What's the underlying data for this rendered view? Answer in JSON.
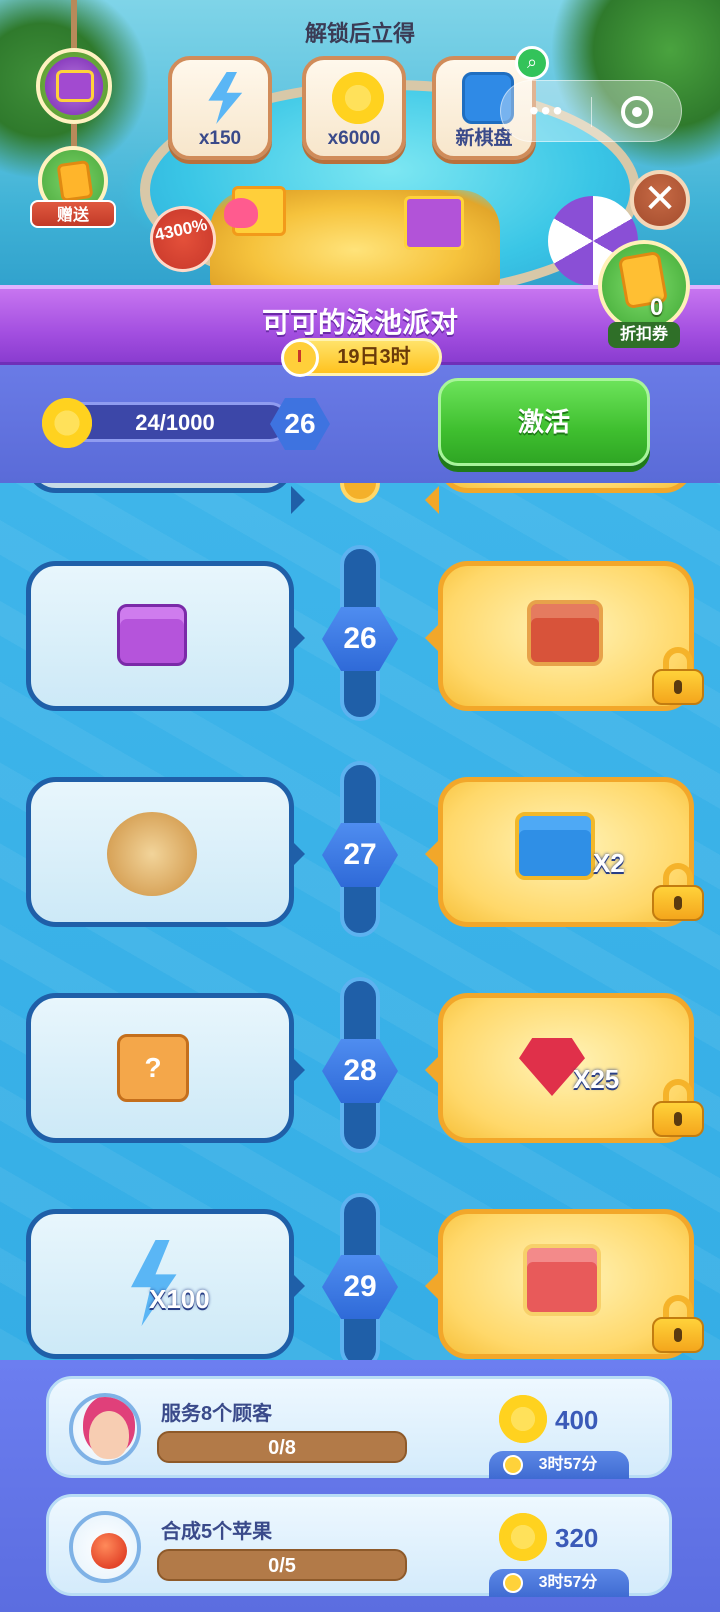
{
  "header": {
    "unlock_title": "解锁后立得",
    "rewards": [
      {
        "label": "x150",
        "icon": "energy-bolt-icon"
      },
      {
        "label": "x6000",
        "icon": "flower-coin-icon"
      },
      {
        "label": "新棋盘",
        "icon": "board-icon"
      }
    ],
    "gift_label": "赠送",
    "bonus_badge": "4300%",
    "discount": {
      "count": "0",
      "label": "折扣券"
    }
  },
  "event": {
    "title": "可可的泳池派对",
    "timer": "19日3时"
  },
  "progress": {
    "text": "24/1000",
    "fraction": 0.024,
    "level": "26",
    "activate_label": "激活"
  },
  "rows": [
    {
      "level": "26",
      "left_item": "purple-chest-icon",
      "left_qty": "",
      "right_item": "red-treasure-chest-icon",
      "right_qty": "",
      "locked": true
    },
    {
      "level": "27",
      "left_item": "fish-plate-icon",
      "left_qty": "",
      "right_item": "blue-chest-icon",
      "right_qty": "X2",
      "locked": true
    },
    {
      "level": "28",
      "left_item": "mystery-box-icon",
      "left_qty": "",
      "right_item": "ruby-gem-icon",
      "right_qty": "X25",
      "locked": true
    },
    {
      "level": "29",
      "left_item": "energy-bolt-icon",
      "left_qty": "X100",
      "right_item": "mystery-chest-icon",
      "right_qty": "",
      "locked": true
    }
  ],
  "tasks": [
    {
      "title": "服务8个顾客",
      "progress": "0/8",
      "reward": "400",
      "timer": "3时57分"
    },
    {
      "title": "合成5个苹果",
      "progress": "0/5",
      "reward": "320",
      "timer": "3时57分"
    }
  ],
  "colors": {
    "accent_purple": "#a34fe0",
    "activate_green": "#3fbf2f",
    "card_gold": "#ffd86a",
    "rail_blue": "#1f5fa8"
  }
}
